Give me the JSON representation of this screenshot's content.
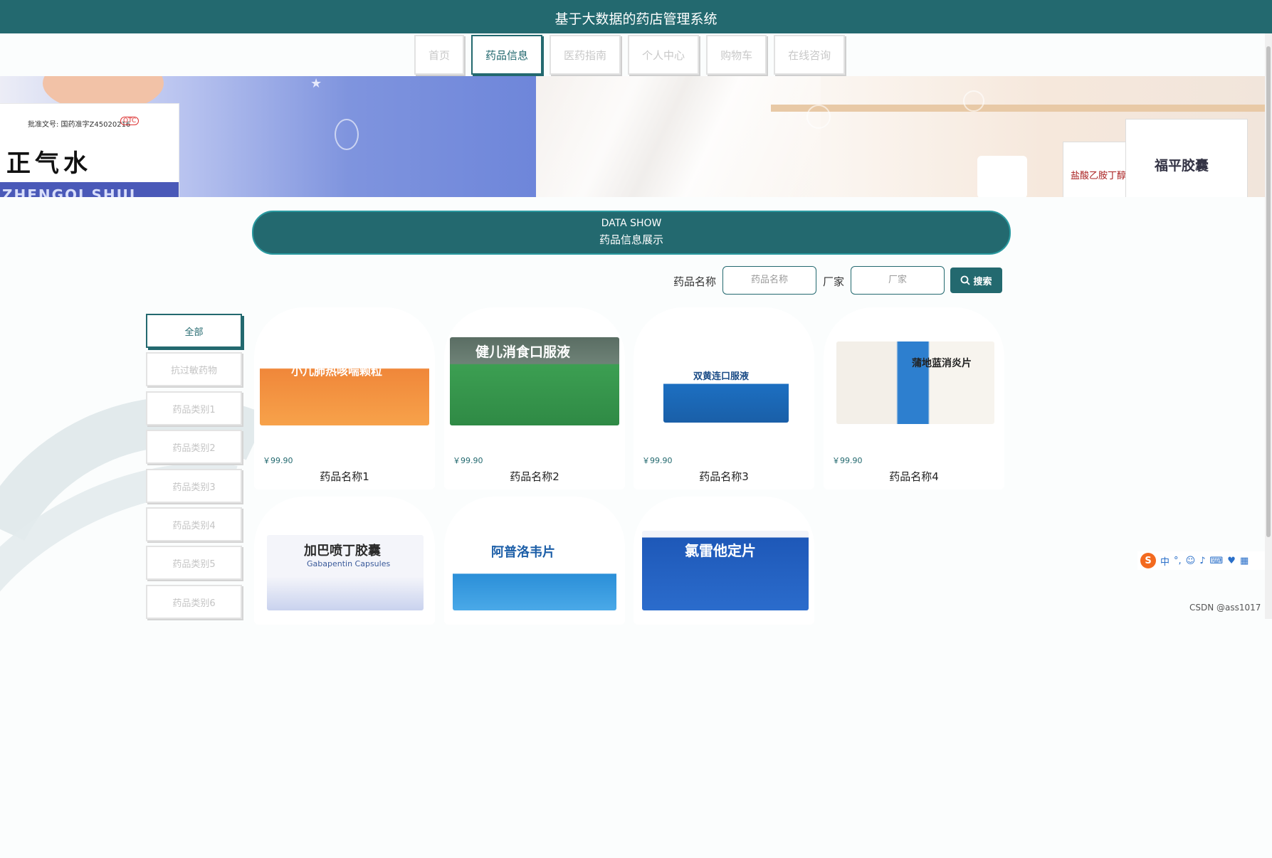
{
  "header": {
    "title": "基于大数据的药店管理系统"
  },
  "nav": {
    "items": [
      {
        "label": "首页"
      },
      {
        "label": "药品信息"
      },
      {
        "label": "医药指南"
      },
      {
        "label": "个人中心"
      },
      {
        "label": "购物车"
      },
      {
        "label": "在线咨询"
      }
    ],
    "active": "药品信息"
  },
  "banner": {
    "left_box_text": "正气水",
    "left_box_band": "ZHENGQI SHUI",
    "left_box_small": "批准文号: 国药准字Z45020216",
    "left_box_badge": "OTC",
    "right_box_text": "福平胶囊",
    "right_box2_text": "盐酸乙胺丁醇片"
  },
  "data_show": {
    "en": "DATA SHOW",
    "cn": "药品信息展示"
  },
  "search": {
    "name_label": "药品名称",
    "name_placeholder": "药品名称",
    "maker_label": "厂家",
    "maker_placeholder": "厂家",
    "button_label": "搜索"
  },
  "categories": {
    "items": [
      "全部",
      "抗过敏药物",
      "药品类别1",
      "药品类别2",
      "药品类别3",
      "药品类别4",
      "药品类别5",
      "药品类别6"
    ],
    "active": "全部"
  },
  "products": [
    {
      "name": "药品名称1",
      "price": "￥99.90",
      "pack_text": "小儿肺热咳喘颗粒"
    },
    {
      "name": "药品名称2",
      "price": "￥99.90",
      "pack_text": "健儿消食口服液"
    },
    {
      "name": "药品名称3",
      "price": "￥99.90",
      "pack_text": "双黄连口服液"
    },
    {
      "name": "药品名称4",
      "price": "￥99.90",
      "pack_text": "蒲地蓝消炎片"
    },
    {
      "name": "",
      "price": "",
      "pack_text": "加巴喷丁胶囊",
      "pack_sub": "Gabapentin Capsules"
    },
    {
      "name": "",
      "price": "",
      "pack_text": "阿普洛韦片"
    },
    {
      "name": "",
      "price": "",
      "pack_text": "氯雷他定片"
    }
  ],
  "ime": {
    "label": "中"
  },
  "watermark": "CSDN @ass1017",
  "colors": {
    "primary": "#23696f",
    "price": "#23696f"
  }
}
